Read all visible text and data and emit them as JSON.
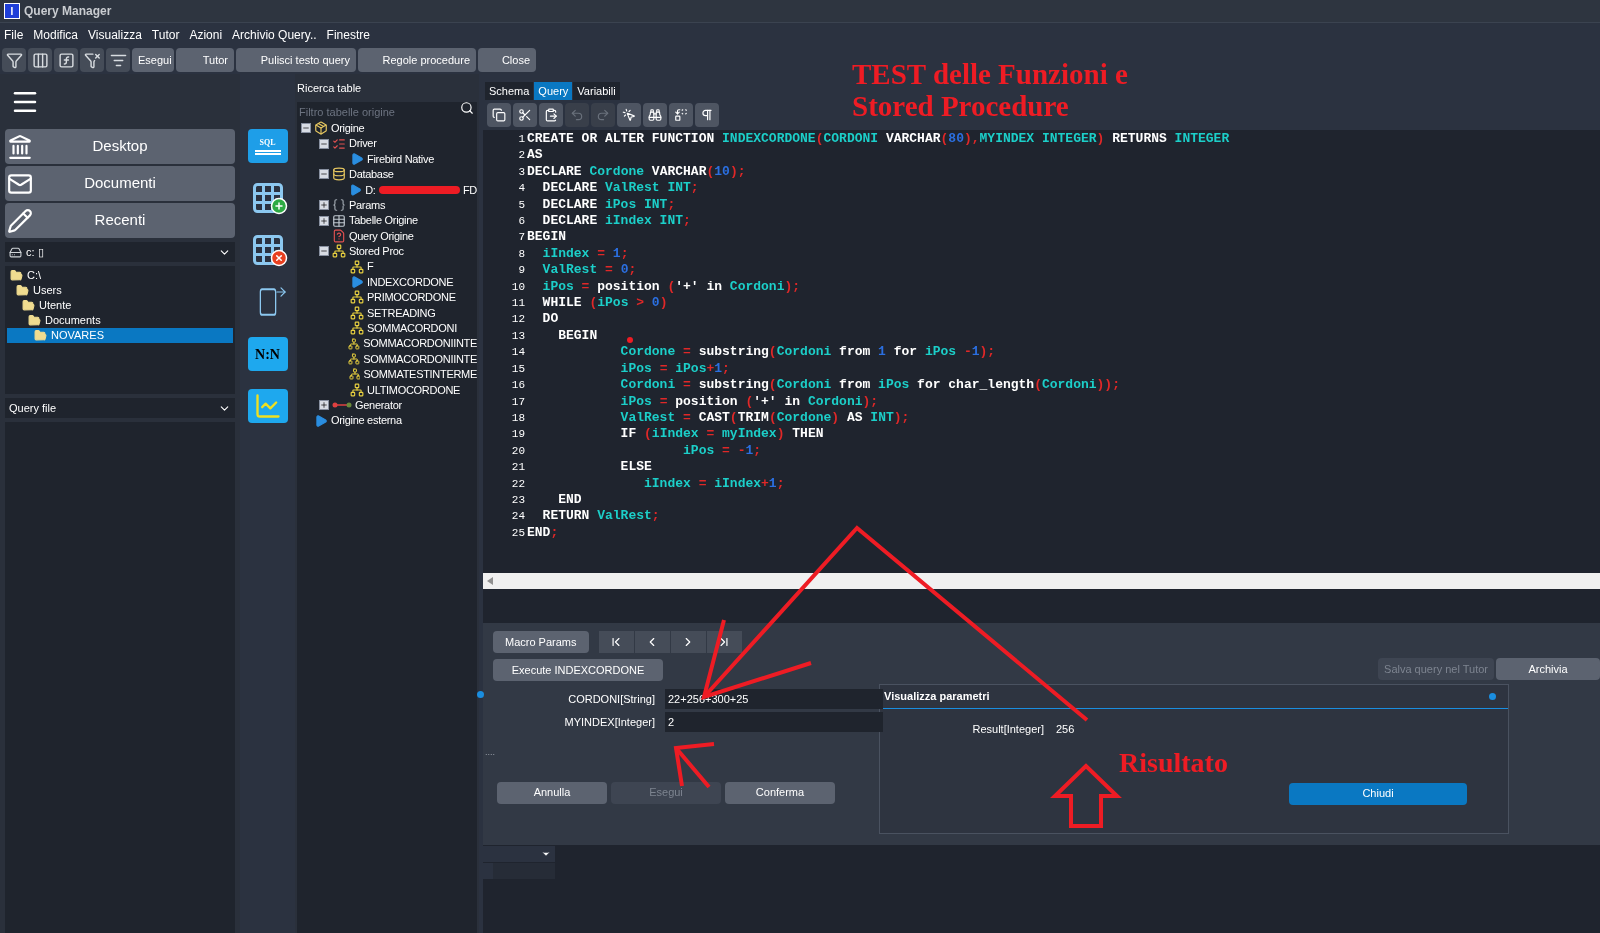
{
  "window": {
    "title": "Query Manager",
    "app_letter": "I"
  },
  "menu": [
    "File",
    "Modifica",
    "Visualizza",
    "Tutor",
    "Azioni",
    "Archivio Query..",
    "Finestre"
  ],
  "toolbar": {
    "icon_buttons": [
      {
        "kind": "filter"
      },
      {
        "kind": "columns"
      },
      {
        "kind": "function"
      },
      {
        "kind": "having"
      },
      {
        "kind": "funnel"
      }
    ],
    "buttons": [
      "Esegui",
      "Tutor",
      "Pulisci testo query",
      "Regole procedure",
      "Close"
    ]
  },
  "sidebar": {
    "nav": [
      {
        "label": "Desktop",
        "kind": "desktop"
      },
      {
        "label": "Documenti",
        "kind": "mail"
      },
      {
        "label": "Recenti",
        "kind": "pencil"
      }
    ],
    "drive": "c: ▯",
    "file_tree": {
      "items": [
        {
          "label": "C:\\",
          "selected": false,
          "children": [
            {
              "label": "Users",
              "selected": false,
              "children": [
                {
                  "label": "Utente",
                  "selected": false,
                  "children": [
                    {
                      "label": "Documents",
                      "selected": false,
                      "children": [
                        {
                          "label": "NOVARES",
                          "selected": true
                        }
                      ]
                    }
                  ]
                }
              ]
            }
          ]
        }
      ]
    },
    "file_filter": "Query file"
  },
  "tools": [
    {
      "kind": "sql",
      "label": "SQL"
    },
    {
      "kind": "table_add"
    },
    {
      "kind": "table_remove"
    },
    {
      "kind": "export"
    },
    {
      "kind": "relation",
      "label": "N:N"
    },
    {
      "kind": "chart"
    }
  ],
  "search": {
    "title": "Ricerca table",
    "placeholder": "Filtro tabelle origine"
  },
  "tree": {
    "items": [
      {
        "label": "Origine",
        "kind": "origin",
        "expanded": true,
        "children": [
          {
            "label": "Driver",
            "kind": "driver",
            "expanded": true,
            "children": [
              {
                "label": "Firebird Native",
                "kind": "play"
              }
            ]
          },
          {
            "label": "Database",
            "kind": "database",
            "expanded": true,
            "children": [
              {
                "label": "D:",
                "label_end": "FD",
                "kind": "play",
                "redacted": true
              }
            ]
          },
          {
            "label": "Params",
            "kind": "params",
            "expanded": false
          },
          {
            "label": "Tabelle Origine",
            "kind": "table",
            "expanded": false
          },
          {
            "label": "Query Origine",
            "kind": "query"
          },
          {
            "label": "Stored Proc",
            "kind": "procedure",
            "expanded": true,
            "children": [
              {
                "label": "F",
                "kind": "procedure"
              },
              {
                "label": "INDEXCORDONE",
                "kind": "play"
              },
              {
                "label": "PRIMOCORDONE",
                "kind": "procedure"
              },
              {
                "label": "SETREADING",
                "kind": "procedure"
              },
              {
                "label": "SOMMACORDONI",
                "kind": "procedure"
              },
              {
                "label": "SOMMACORDONIINTE",
                "kind": "procedure"
              },
              {
                "label": "SOMMACORDONIINTE",
                "kind": "procedure"
              },
              {
                "label": "SOMMATESTINTERME",
                "kind": "procedure"
              },
              {
                "label": "ULTIMOCORDONE",
                "kind": "procedure"
              }
            ]
          },
          {
            "label": "Generator",
            "kind": "generator",
            "expanded": false
          }
        ]
      },
      {
        "label": "Origine esterna",
        "kind": "play"
      }
    ]
  },
  "tabs": [
    {
      "label": "Schema",
      "selected": false
    },
    {
      "label": "Query",
      "selected": true
    },
    {
      "label": "Variabili",
      "selected": false
    }
  ],
  "editor_tools": [
    {
      "kind": "copy",
      "disabled": false
    },
    {
      "kind": "cut",
      "disabled": false
    },
    {
      "kind": "paste",
      "disabled": false
    },
    {
      "kind": "undo",
      "disabled": true
    },
    {
      "kind": "redo",
      "disabled": true
    },
    {
      "kind": "select",
      "disabled": false
    },
    {
      "kind": "find",
      "disabled": false
    },
    {
      "kind": "replace",
      "disabled": false
    },
    {
      "kind": "pilcrow",
      "disabled": false
    }
  ],
  "code": [
    {
      "number": "1",
      "tokens": [
        {
          "kind": "keyword",
          "text": "CREATE OR ALTER FUNCTION "
        },
        {
          "kind": "identifier",
          "text": "INDEXCORDONE"
        },
        {
          "kind": "symbol",
          "text": "("
        },
        {
          "kind": "identifier",
          "text": "CORDONI"
        },
        {
          "kind": "keyword",
          "text": " VARCHAR"
        },
        {
          "kind": "symbol",
          "text": "("
        },
        {
          "kind": "number",
          "text": "80"
        },
        {
          "kind": "symbol",
          "text": "),"
        },
        {
          "kind": "identifier",
          "text": "MYINDEX INTEGER"
        },
        {
          "kind": "symbol",
          "text": ")"
        },
        {
          "kind": "keyword",
          "text": " RETURNS "
        },
        {
          "kind": "identifier",
          "text": "INTEGER"
        }
      ]
    },
    {
      "number": "2",
      "tokens": [
        {
          "kind": "keyword",
          "text": "AS"
        }
      ]
    },
    {
      "number": "3",
      "tokens": [
        {
          "kind": "keyword",
          "text": "DECLARE "
        },
        {
          "kind": "identifier",
          "text": "Cordone"
        },
        {
          "kind": "keyword",
          "text": " VARCHAR"
        },
        {
          "kind": "symbol",
          "text": "("
        },
        {
          "kind": "number",
          "text": "10"
        },
        {
          "kind": "symbol",
          "text": ");"
        }
      ]
    },
    {
      "number": "4",
      "tokens": [
        {
          "kind": "keyword",
          "text": "  DECLARE "
        },
        {
          "kind": "identifier",
          "text": "ValRest INT"
        },
        {
          "kind": "symbol",
          "text": ";"
        }
      ]
    },
    {
      "number": "5",
      "tokens": [
        {
          "kind": "keyword",
          "text": "  DECLARE "
        },
        {
          "kind": "identifier",
          "text": "iPos INT"
        },
        {
          "kind": "symbol",
          "text": ";"
        }
      ]
    },
    {
      "number": "6",
      "tokens": [
        {
          "kind": "keyword",
          "text": "  DECLARE "
        },
        {
          "kind": "identifier",
          "text": "iIndex INT"
        },
        {
          "kind": "symbol",
          "text": ";"
        }
      ]
    },
    {
      "number": "7",
      "tokens": [
        {
          "kind": "keyword",
          "text": "BEGIN"
        }
      ]
    },
    {
      "number": "8",
      "tokens": [
        {
          "kind": "identifier",
          "text": "  iIndex"
        },
        {
          "kind": "symbol",
          "text": " = "
        },
        {
          "kind": "number",
          "text": "1"
        },
        {
          "kind": "symbol",
          "text": ";"
        }
      ]
    },
    {
      "number": "9",
      "tokens": [
        {
          "kind": "identifier",
          "text": "  ValRest"
        },
        {
          "kind": "symbol",
          "text": " = "
        },
        {
          "kind": "number",
          "text": "0"
        },
        {
          "kind": "symbol",
          "text": ";"
        }
      ]
    },
    {
      "number": "10",
      "tokens": [
        {
          "kind": "identifier",
          "text": "  iPos"
        },
        {
          "kind": "symbol",
          "text": " = "
        },
        {
          "kind": "keyword",
          "text": "position "
        },
        {
          "kind": "symbol",
          "text": "("
        },
        {
          "kind": "keyword",
          "text": "'+' in "
        },
        {
          "kind": "identifier",
          "text": "Cordoni"
        },
        {
          "kind": "symbol",
          "text": ");"
        }
      ]
    },
    {
      "number": "11",
      "tokens": [
        {
          "kind": "keyword",
          "text": "  WHILE "
        },
        {
          "kind": "symbol",
          "text": "("
        },
        {
          "kind": "identifier",
          "text": "iPos"
        },
        {
          "kind": "symbol",
          "text": " > "
        },
        {
          "kind": "number",
          "text": "0"
        },
        {
          "kind": "symbol",
          "text": ")"
        }
      ]
    },
    {
      "number": "12",
      "tokens": [
        {
          "kind": "keyword",
          "text": "  DO"
        }
      ]
    },
    {
      "number": "13",
      "tokens": [
        {
          "kind": "keyword",
          "text": "    BEGIN"
        }
      ]
    },
    {
      "number": "14",
      "tokens": [
        {
          "kind": "identifier",
          "text": "            Cordone"
        },
        {
          "kind": "symbol",
          "text": " = "
        },
        {
          "kind": "keyword",
          "text": "substring"
        },
        {
          "kind": "symbol",
          "text": "("
        },
        {
          "kind": "identifier",
          "text": "Cordoni"
        },
        {
          "kind": "keyword",
          "text": " from "
        },
        {
          "kind": "number",
          "text": "1"
        },
        {
          "kind": "keyword",
          "text": " for "
        },
        {
          "kind": "identifier",
          "text": "iPos"
        },
        {
          "kind": "symbol",
          "text": " -"
        },
        {
          "kind": "number",
          "text": "1"
        },
        {
          "kind": "symbol",
          "text": ");"
        }
      ]
    },
    {
      "number": "15",
      "tokens": [
        {
          "kind": "identifier",
          "text": "            iPos"
        },
        {
          "kind": "symbol",
          "text": " = "
        },
        {
          "kind": "identifier",
          "text": "iPos"
        },
        {
          "kind": "symbol",
          "text": "+"
        },
        {
          "kind": "number",
          "text": "1"
        },
        {
          "kind": "symbol",
          "text": ";"
        }
      ]
    },
    {
      "number": "16",
      "tokens": [
        {
          "kind": "identifier",
          "text": "            Cordoni"
        },
        {
          "kind": "symbol",
          "text": " = "
        },
        {
          "kind": "keyword",
          "text": "substring"
        },
        {
          "kind": "symbol",
          "text": "("
        },
        {
          "kind": "identifier",
          "text": "Cordoni"
        },
        {
          "kind": "keyword",
          "text": " from "
        },
        {
          "kind": "identifier",
          "text": "iPos"
        },
        {
          "kind": "keyword",
          "text": " for char_length"
        },
        {
          "kind": "symbol",
          "text": "("
        },
        {
          "kind": "identifier",
          "text": "Cordoni"
        },
        {
          "kind": "symbol",
          "text": "));"
        }
      ]
    },
    {
      "number": "17",
      "tokens": [
        {
          "kind": "identifier",
          "text": "            iPos"
        },
        {
          "kind": "symbol",
          "text": " = "
        },
        {
          "kind": "keyword",
          "text": "position "
        },
        {
          "kind": "symbol",
          "text": "("
        },
        {
          "kind": "keyword",
          "text": "'+' in "
        },
        {
          "kind": "identifier",
          "text": "Cordoni"
        },
        {
          "kind": "symbol",
          "text": ");"
        }
      ]
    },
    {
      "number": "18",
      "tokens": [
        {
          "kind": "identifier",
          "text": "            ValRest"
        },
        {
          "kind": "symbol",
          "text": " = "
        },
        {
          "kind": "keyword",
          "text": "CAST"
        },
        {
          "kind": "symbol",
          "text": "("
        },
        {
          "kind": "keyword",
          "text": "TRIM"
        },
        {
          "kind": "symbol",
          "text": "("
        },
        {
          "kind": "identifier",
          "text": "Cordone"
        },
        {
          "kind": "symbol",
          "text": ")"
        },
        {
          "kind": "keyword",
          "text": " AS "
        },
        {
          "kind": "identifier",
          "text": "INT"
        },
        {
          "kind": "symbol",
          "text": ");"
        }
      ]
    },
    {
      "number": "19",
      "tokens": [
        {
          "kind": "keyword",
          "text": "            IF "
        },
        {
          "kind": "symbol",
          "text": "("
        },
        {
          "kind": "identifier",
          "text": "iIndex"
        },
        {
          "kind": "symbol",
          "text": " = "
        },
        {
          "kind": "identifier",
          "text": "myIndex"
        },
        {
          "kind": "symbol",
          "text": ")"
        },
        {
          "kind": "keyword",
          "text": " THEN"
        }
      ]
    },
    {
      "number": "20",
      "tokens": [
        {
          "kind": "identifier",
          "text": "                    iPos"
        },
        {
          "kind": "symbol",
          "text": " = -"
        },
        {
          "kind": "number",
          "text": "1"
        },
        {
          "kind": "symbol",
          "text": ";"
        }
      ]
    },
    {
      "number": "21",
      "tokens": [
        {
          "kind": "keyword",
          "text": "            ELSE"
        }
      ]
    },
    {
      "number": "22",
      "tokens": [
        {
          "kind": "identifier",
          "text": "               iIndex"
        },
        {
          "kind": "symbol",
          "text": " = "
        },
        {
          "kind": "identifier",
          "text": "iIndex"
        },
        {
          "kind": "symbol",
          "text": "+"
        },
        {
          "kind": "number",
          "text": "1"
        },
        {
          "kind": "symbol",
          "text": ";"
        }
      ]
    },
    {
      "number": "23",
      "tokens": [
        {
          "kind": "keyword",
          "text": "    END"
        }
      ]
    },
    {
      "number": "24",
      "tokens": [
        {
          "kind": "keyword",
          "text": "  RETURN "
        },
        {
          "kind": "identifier",
          "text": "ValRest"
        },
        {
          "kind": "symbol",
          "text": ";"
        }
      ]
    },
    {
      "number": "25",
      "tokens": [
        {
          "kind": "keyword",
          "text": "END"
        },
        {
          "kind": "symbol",
          "text": ";"
        }
      ]
    }
  ],
  "execute_panel": {
    "macro_button": "Macro Params",
    "execute_button": "Execute INDEXCORDONE",
    "params": [
      {
        "label": "CORDONI[String]",
        "value": "22+256+300+25"
      },
      {
        "label": "MYINDEX[Integer]",
        "value": "2"
      }
    ],
    "dots": "....",
    "actions": [
      {
        "label": "Annulla",
        "disabled": false
      },
      {
        "label": "Esegui",
        "disabled": true
      },
      {
        "label": "Conferma",
        "disabled": false
      }
    ],
    "side_buttons": [
      {
        "label": "Salva query nel Tutor",
        "disabled": true
      },
      {
        "label": "Archivia",
        "disabled": false
      }
    ]
  },
  "result_dialog": {
    "title": "Visualizza parametri",
    "label": "Result[Integer]",
    "value": "256",
    "button": "Chiudi"
  },
  "annotations": {
    "title": "TEST delle Funzioni e Stored Procedure",
    "result": "Risultato"
  }
}
